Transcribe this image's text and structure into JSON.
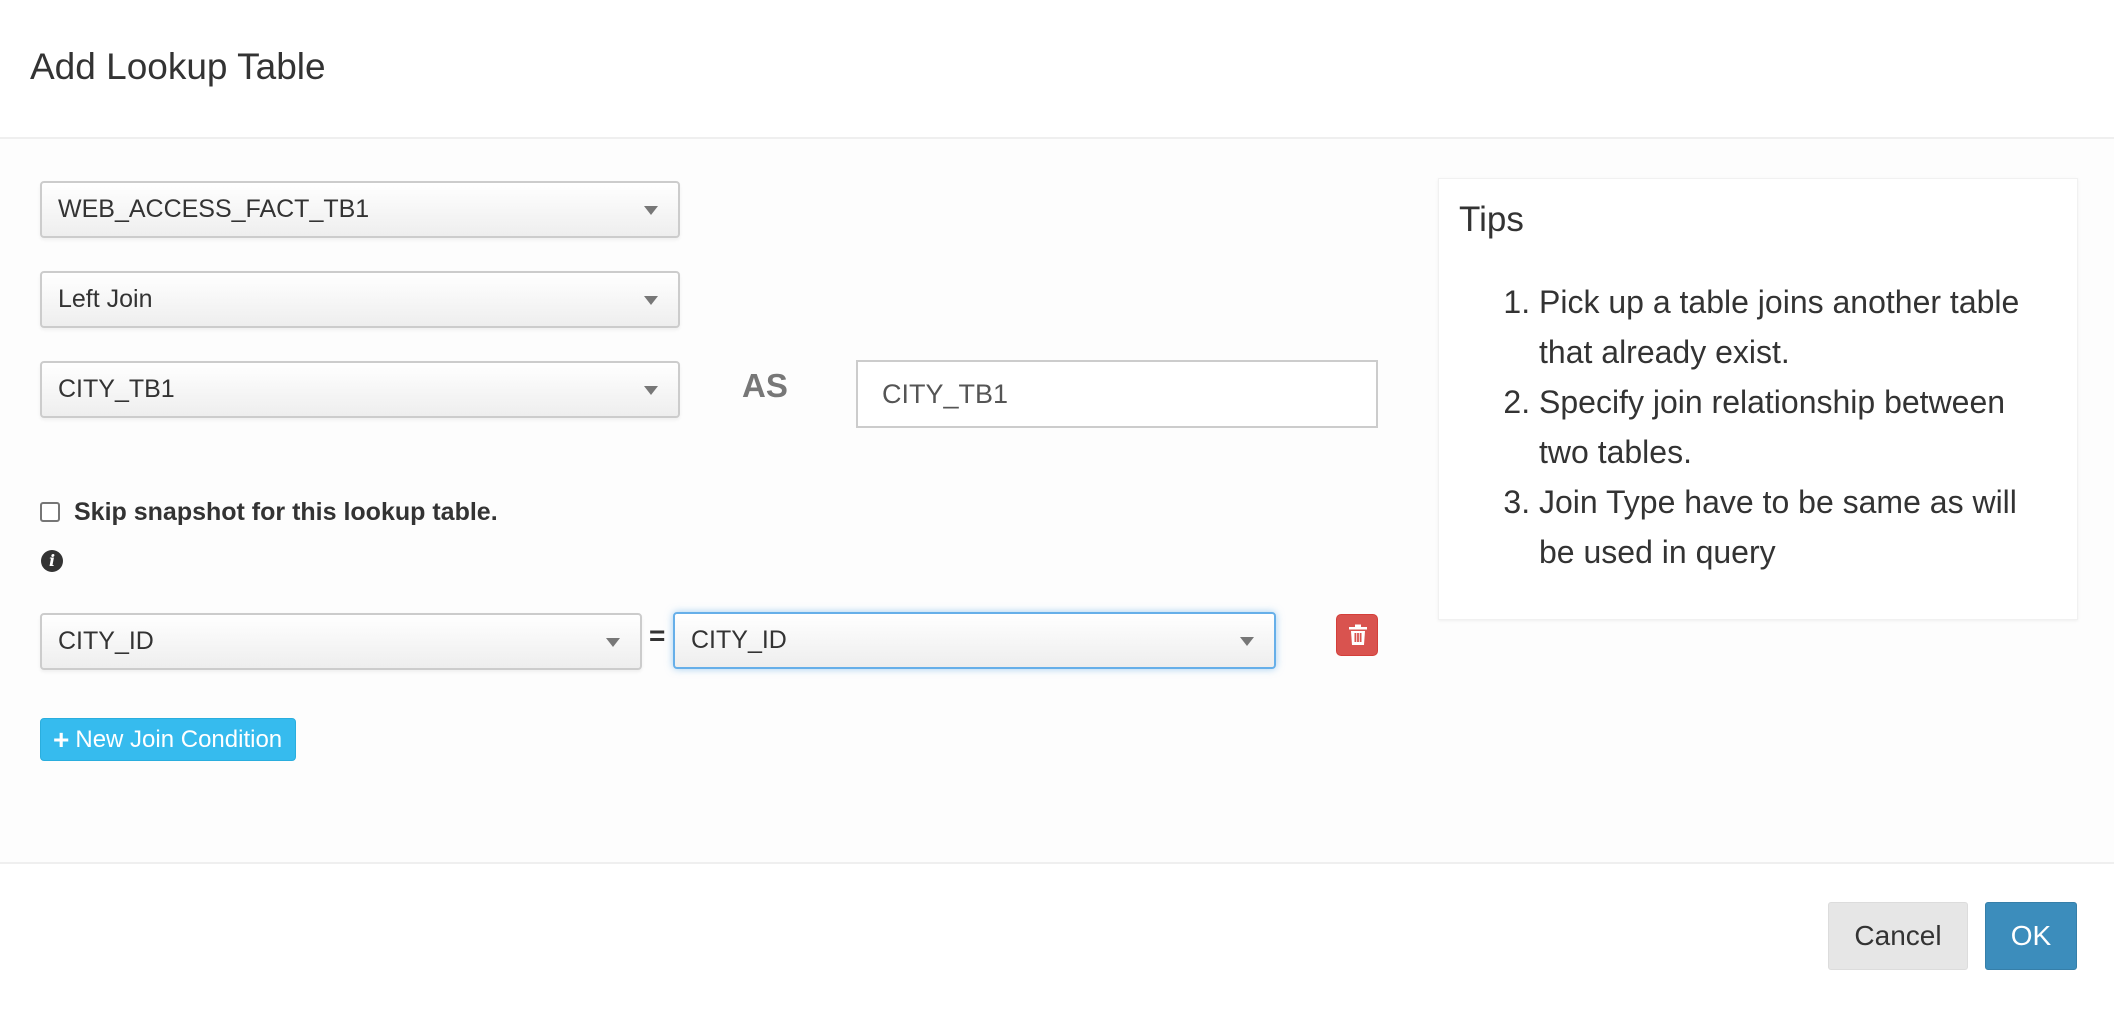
{
  "dialog": {
    "title": "Add Lookup Table"
  },
  "form": {
    "fact_table": "WEB_ACCESS_FACT_TB1",
    "join_type": "Left Join",
    "lookup_table": "CITY_TB1",
    "as_label": "AS",
    "alias_value": "CITY_TB1",
    "skip_snapshot_label": "Skip snapshot for this lookup table.",
    "skip_snapshot_checked": false,
    "info_icon": "info-circle-icon",
    "join_conditions": [
      {
        "left_column": "CITY_ID",
        "operator": "=",
        "right_column": "CITY_ID"
      }
    ],
    "delete_icon": "trash-icon",
    "new_join_label": "New Join Condition",
    "new_join_icon": "plus-icon"
  },
  "tips": {
    "title": "Tips",
    "items": [
      "Pick up a table joins another table that already exist.",
      "Specify join relationship between two tables.",
      "Join Type have to be same as will be used in query"
    ]
  },
  "footer": {
    "cancel_label": "Cancel",
    "ok_label": "OK"
  },
  "colors": {
    "primary": "#3c8dbc",
    "info": "#36bbee",
    "danger": "#d9534f",
    "focus": "#66afe9"
  }
}
